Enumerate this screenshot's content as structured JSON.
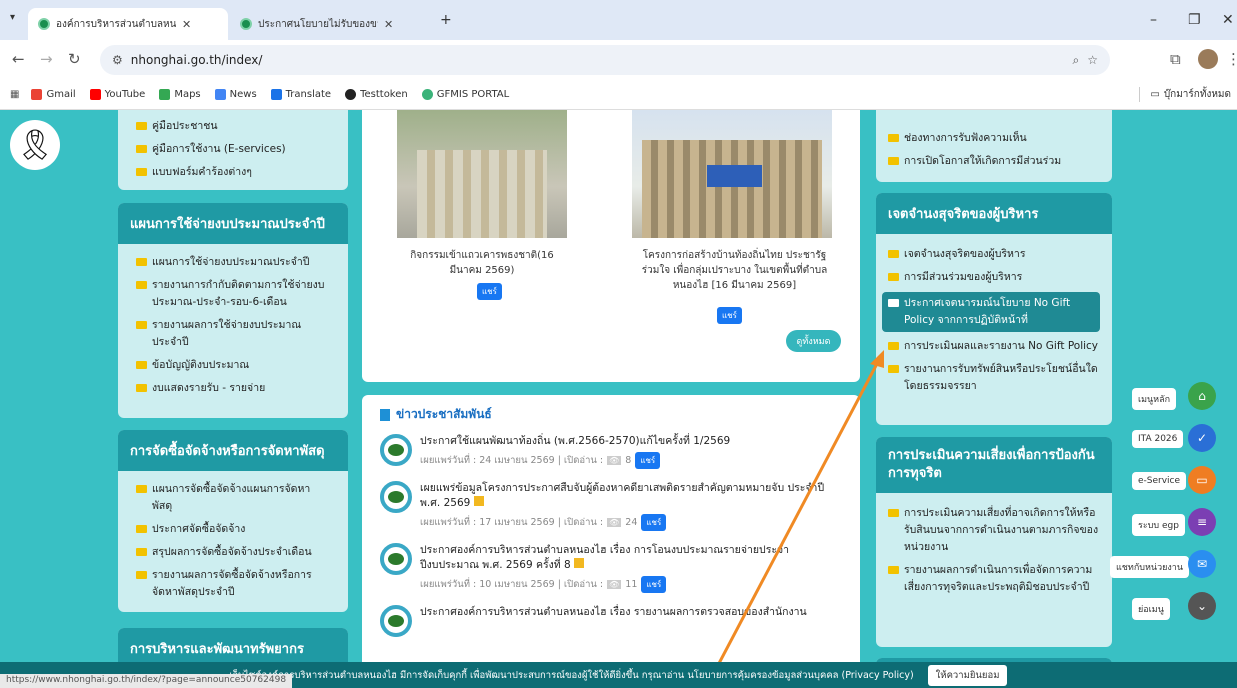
{
  "browser": {
    "tabs": [
      {
        "title": "องค์การบริหารส่วนตำบลหนองไฮ อำเ"
      },
      {
        "title": "ประกาศนโยบายไม่รับของขวัญของกำ"
      }
    ],
    "new_tab": "+",
    "url": "nhonghai.go.th/index/",
    "bookmarks": [
      "Gmail",
      "YouTube",
      "Maps",
      "News",
      "Translate",
      "Testtoken",
      "GFMIS PORTAL"
    ],
    "bookmarks_folder": "บุ๊กมาร์กทั้งหมด",
    "status_url": "https://www.nhonghai.go.th/index/?page=announce50762498"
  },
  "left": {
    "top_items": [
      "คู่มือประชาชน",
      "คู่มือการใช้งาน (E-services)",
      "แบบฟอร์มคำร้องต่างๆ"
    ],
    "budget_title": "แผนการใช้จ่ายงบประมาณประจำปี",
    "budget_items": [
      "แผนการใช้จ่ายงบประมาณประจำปี",
      "รายงานการกำกับติดตามการใช้จ่ายงบประมาณ-ประจำ-รอบ-6-เดือน",
      "รายงานผลการใช้จ่ายงบประมาณประจำปี",
      "ข้อบัญญัติงบประมาณ",
      "งบแสดงรายรับ - รายจ่าย"
    ],
    "procure_title": "การจัดซื้อจัดจ้างหรือการจัดหาพัสดุ",
    "procure_items": [
      "แผนการจัดซื้อจัดจ้างแผนการจัดหาพัสดุ",
      "ประกาศจัดซื้อจัดจ้าง",
      "สรุปผลการจัดซื้อจัดจ้างประจำเดือน",
      "รายงานผลการจัดซื้อจัดจ้างหรือการจัดหาพัสดุประจำปี"
    ],
    "hr_title": "การบริหารและพัฒนาทรัพยากร"
  },
  "center": {
    "photo1_caption": "กิจกรรมเข้าแถวเคารพธงชาติ(16 มีนาคม 2569)",
    "photo2_caption": "โครงการก่อสร้างบ้านท้องถิ่นไทย ประชารัฐร่วมใจ เพื่อกลุ่มเปราะบาง ในเขตพื้นที่ตำบลหนองไฮ [16 มีนาคม 2569]",
    "share": "แชร์",
    "view_all": "ดูทั้งหมด",
    "news_title": "ข่าวประชาสัมพันธ์",
    "news": [
      {
        "title": "ประกาศใช้แผนพัฒนาท้องถิ่น (พ.ศ.2566-2570)แก้ไขครั้งที่ 1/2569",
        "meta": "เผยแพร่วันที่ : 24 เมษายน 2569 | เปิดอ่าน :",
        "views": "8"
      },
      {
        "title": "เผยแพร่ข้อมูลโครงการประกาศสืบจับผู้ต้องหาคดียาเสพติดรายสำคัญตามหมายจับ ประจำปี พ.ศ. 2569",
        "meta": "เผยแพร่วันที่ : 17 เมษายน 2569 | เปิดอ่าน :",
        "views": "24"
      },
      {
        "title": "ประกาศองค์การบริหารส่วนตำบลหนองไฮ เรื่อง การโอนงบประมาณรายจ่ายประจำปีงบประมาณ พ.ศ. 2569 ครั้งที่ 8",
        "meta": "เผยแพร่วันที่ : 10 เมษายน 2569 | เปิดอ่าน :",
        "views": "11"
      },
      {
        "title": "ประกาศองค์การบริหารส่วนตำบลหนองไฮ เรื่อง รายงานผลการตรวจสอบของสำนักงาน"
      }
    ]
  },
  "right": {
    "top_items": [
      "ช่องทางการรับฟังความเห็น",
      "การเปิดโอกาสให้เกิดการมีส่วนร่วม"
    ],
    "integrity_title": "เจตจำนงสุจริตของผู้บริหาร",
    "integrity_items": [
      "เจตจำนงสุจริตของผู้บริหาร",
      "การมีส่วนร่วมของผู้บริหาร",
      "ประกาศเจตนารมณ์นโยบาย No Gift Policy จากการปฏิบัติหน้าที่",
      "การประเมินผลและรายงาน No Gift Policy",
      "รายงานการรับทรัพย์สินหรือประโยชน์อื่นใดโดยธรรมจรรยา"
    ],
    "risk_title": "การประเมินความเสี่ยงเพื่อการป้องกันการทุจริต",
    "risk_items": [
      "การประเมินความเสี่ยงที่อาจเกิดการให้หรือรับสินบนจากการดำเนินงานตามภารกิจของหน่วยงาน",
      "รายงานผลการดำเนินการเพื่อจัดการความเสี่ยงการทุจริตและประพฤติมิชอบประจำปี"
    ]
  },
  "fab": [
    "เมนูหลัก",
    "ITA 2026",
    "e-Service",
    "ระบบ egp",
    "แชทกับหน่วยงาน",
    "ย่อเมนู"
  ],
  "cookie": {
    "text": "เว็บไซต์องค์การบริหารส่วนตำบลหนองไฮ มีการจัดเก็บคุกกี้ เพื่อพัฒนาประสบการณ์ของผู้ใช้ให้ดียิ่งขึ้น กรุณาอ่าน นโยบายการคุ้มครองข้อมูลส่วนบุคคล (Privacy Policy)",
    "accept": "ให้ความยินยอม"
  },
  "colors": {
    "teal": "#39c0c4",
    "header": "#1f9aa4",
    "panel": "#cdeef0",
    "arrow": "#f08a24"
  }
}
